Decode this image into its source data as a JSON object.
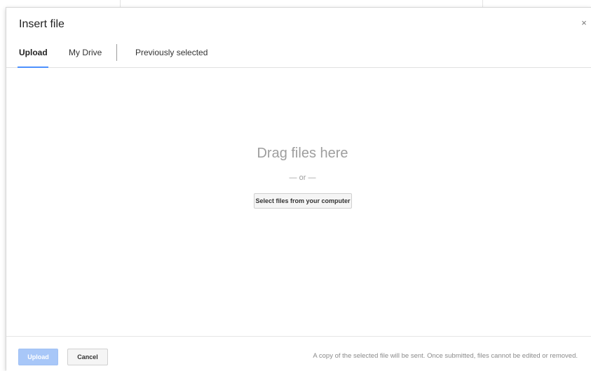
{
  "dialog": {
    "title": "Insert file",
    "close_label": "×"
  },
  "tabs": [
    {
      "label": "Upload",
      "active": true
    },
    {
      "label": "My Drive",
      "active": false
    },
    {
      "label": "Previously selected",
      "active": false
    }
  ],
  "drop_zone": {
    "title": "Drag files here",
    "or_text": "— or —",
    "select_button_label": "Select files from your computer"
  },
  "footer": {
    "upload_label": "Upload",
    "cancel_label": "Cancel",
    "note": "A copy of the selected file will be sent. Once submitted, files cannot be edited or removed."
  },
  "colors": {
    "accent": "#4d90fe",
    "upload_disabled": "#a8c7f8",
    "muted_text": "#9e9e9e"
  },
  "icons": {
    "close": "close-icon"
  }
}
